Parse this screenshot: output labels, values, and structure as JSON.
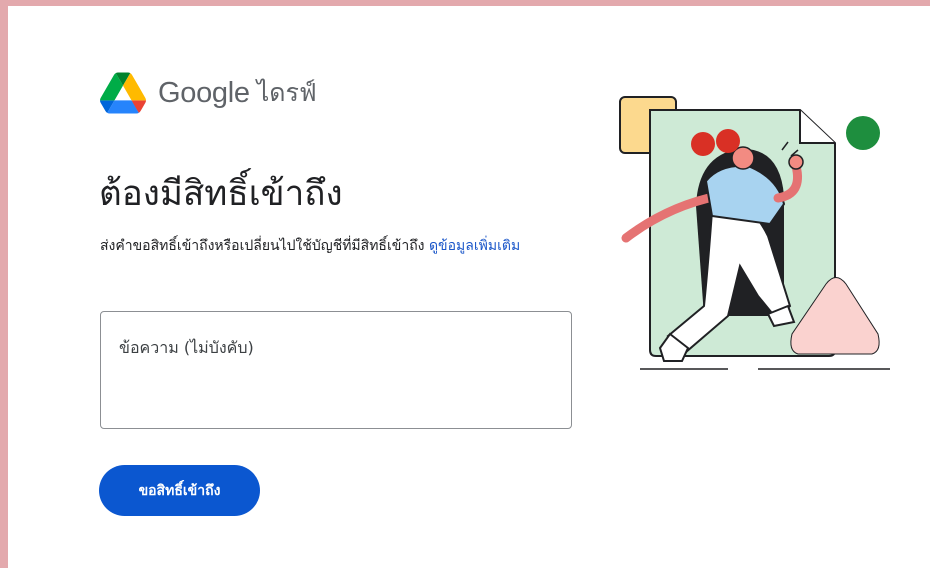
{
  "header": {
    "brand": "Google",
    "product": "ไดรฟ์"
  },
  "main": {
    "title": "ต้องมีสิทธิ์เข้าถึง",
    "description": "ส่งคำขอสิทธิ์เข้าถึงหรือเปลี่ยนไปใช้บัญชีที่มีสิทธิ์เข้าถึง",
    "learn_more_link": "ดูข้อมูลเพิ่มเติม",
    "message_placeholder": "ข้อความ (ไม่บังคับ)",
    "request_button": "ขอสิทธิ์เข้าถึง"
  },
  "colors": {
    "primary_button": "#0b57d0",
    "link": "#1a56c9",
    "frame_background": "#e3a9ad"
  },
  "icons": {
    "logo": "google-drive-logo",
    "illustration": "person-stepping-out-of-document"
  }
}
